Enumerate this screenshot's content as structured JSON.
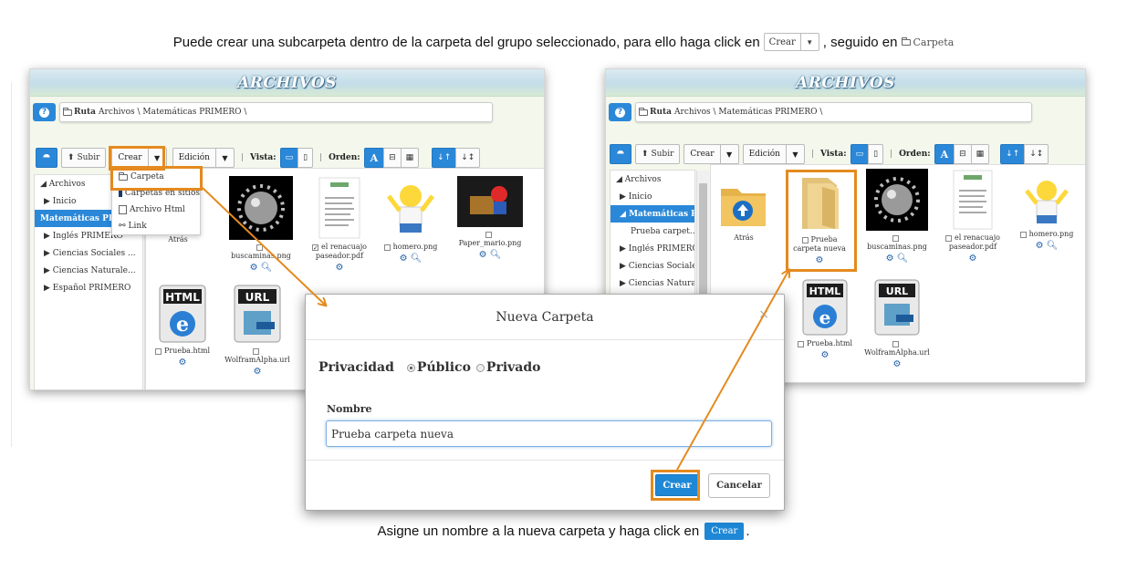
{
  "captions": {
    "top_text": "Puede crear una subcarpeta dentro de la carpeta del grupo seleccionado, para ello haga click en",
    "top_button": "Crear",
    "top_mid": ", seguido en",
    "top_folder": "Carpeta",
    "bottom_text": "Asigne un nombre a la nueva carpeta y haga click en",
    "bottom_button": "Crear",
    "bottom_end": "."
  },
  "left_panel": {
    "title": "ARCHIVOS",
    "route_label": "Ruta",
    "route_path": "Archivos \\ Matemáticas PRIMERO \\",
    "toolbar": {
      "subir": "Subir",
      "crear": "Crear",
      "edicion": "Edición",
      "vista": "Vista:",
      "orden": "Orden:",
      "orden_a": "A"
    },
    "sidebar": [
      "Archivos",
      "Inicio",
      "Matemáticas PRIMERO",
      "Inglés PRIMERO",
      "Ciencias Sociales ...",
      "Ciencias Naturale...",
      "Español PRIMERO"
    ],
    "dropdown": [
      "Carpeta",
      "Carpetas en sitios",
      "Archivo Html",
      "Link"
    ],
    "files": [
      {
        "name": "Atrás"
      },
      {
        "name": "buscaminas.png"
      },
      {
        "name": "el renacuajo paseador.pdf"
      },
      {
        "name": "homero.png"
      },
      {
        "name": "Paper_mario.png"
      },
      {
        "name": "Prueba.html"
      },
      {
        "name": "WolframAlpha.url"
      }
    ]
  },
  "right_panel": {
    "title": "ARCHIVOS",
    "route_label": "Ruta",
    "route_path": "Archivos \\ Matemáticas PRIMERO \\",
    "toolbar": {
      "subir": "Subir",
      "crear": "Crear",
      "edicion": "Edición",
      "vista": "Vista:",
      "orden": "Orden:",
      "orden_a": "A"
    },
    "sidebar": [
      "Archivos",
      "Inicio",
      "Matemáticas P...",
      "Prueba carpet...",
      "Inglés PRIMERO",
      "Ciencias Sociale...",
      "Ciencias Natura..."
    ],
    "files": [
      {
        "name": "Atrás"
      },
      {
        "name": "Prueba carpeta nueva"
      },
      {
        "name": "buscaminas.png"
      },
      {
        "name": "el renacuajo paseador.pdf"
      },
      {
        "name": "homero.png"
      },
      {
        "name": "Prueba.html"
      },
      {
        "name": "WolframAlpha.url"
      }
    ]
  },
  "modal": {
    "title": "Nueva Carpeta",
    "privacy_label": "Privacidad",
    "option_public": "Público",
    "option_private": "Privado",
    "name_label": "Nombre",
    "name_value": "Prueba carpeta nueva",
    "create_button": "Crear",
    "cancel_button": "Cancelar"
  },
  "colors": {
    "highlight": "#e48a1e",
    "primary": "#2b88d8",
    "panel_bg": "#f4f7ec"
  }
}
